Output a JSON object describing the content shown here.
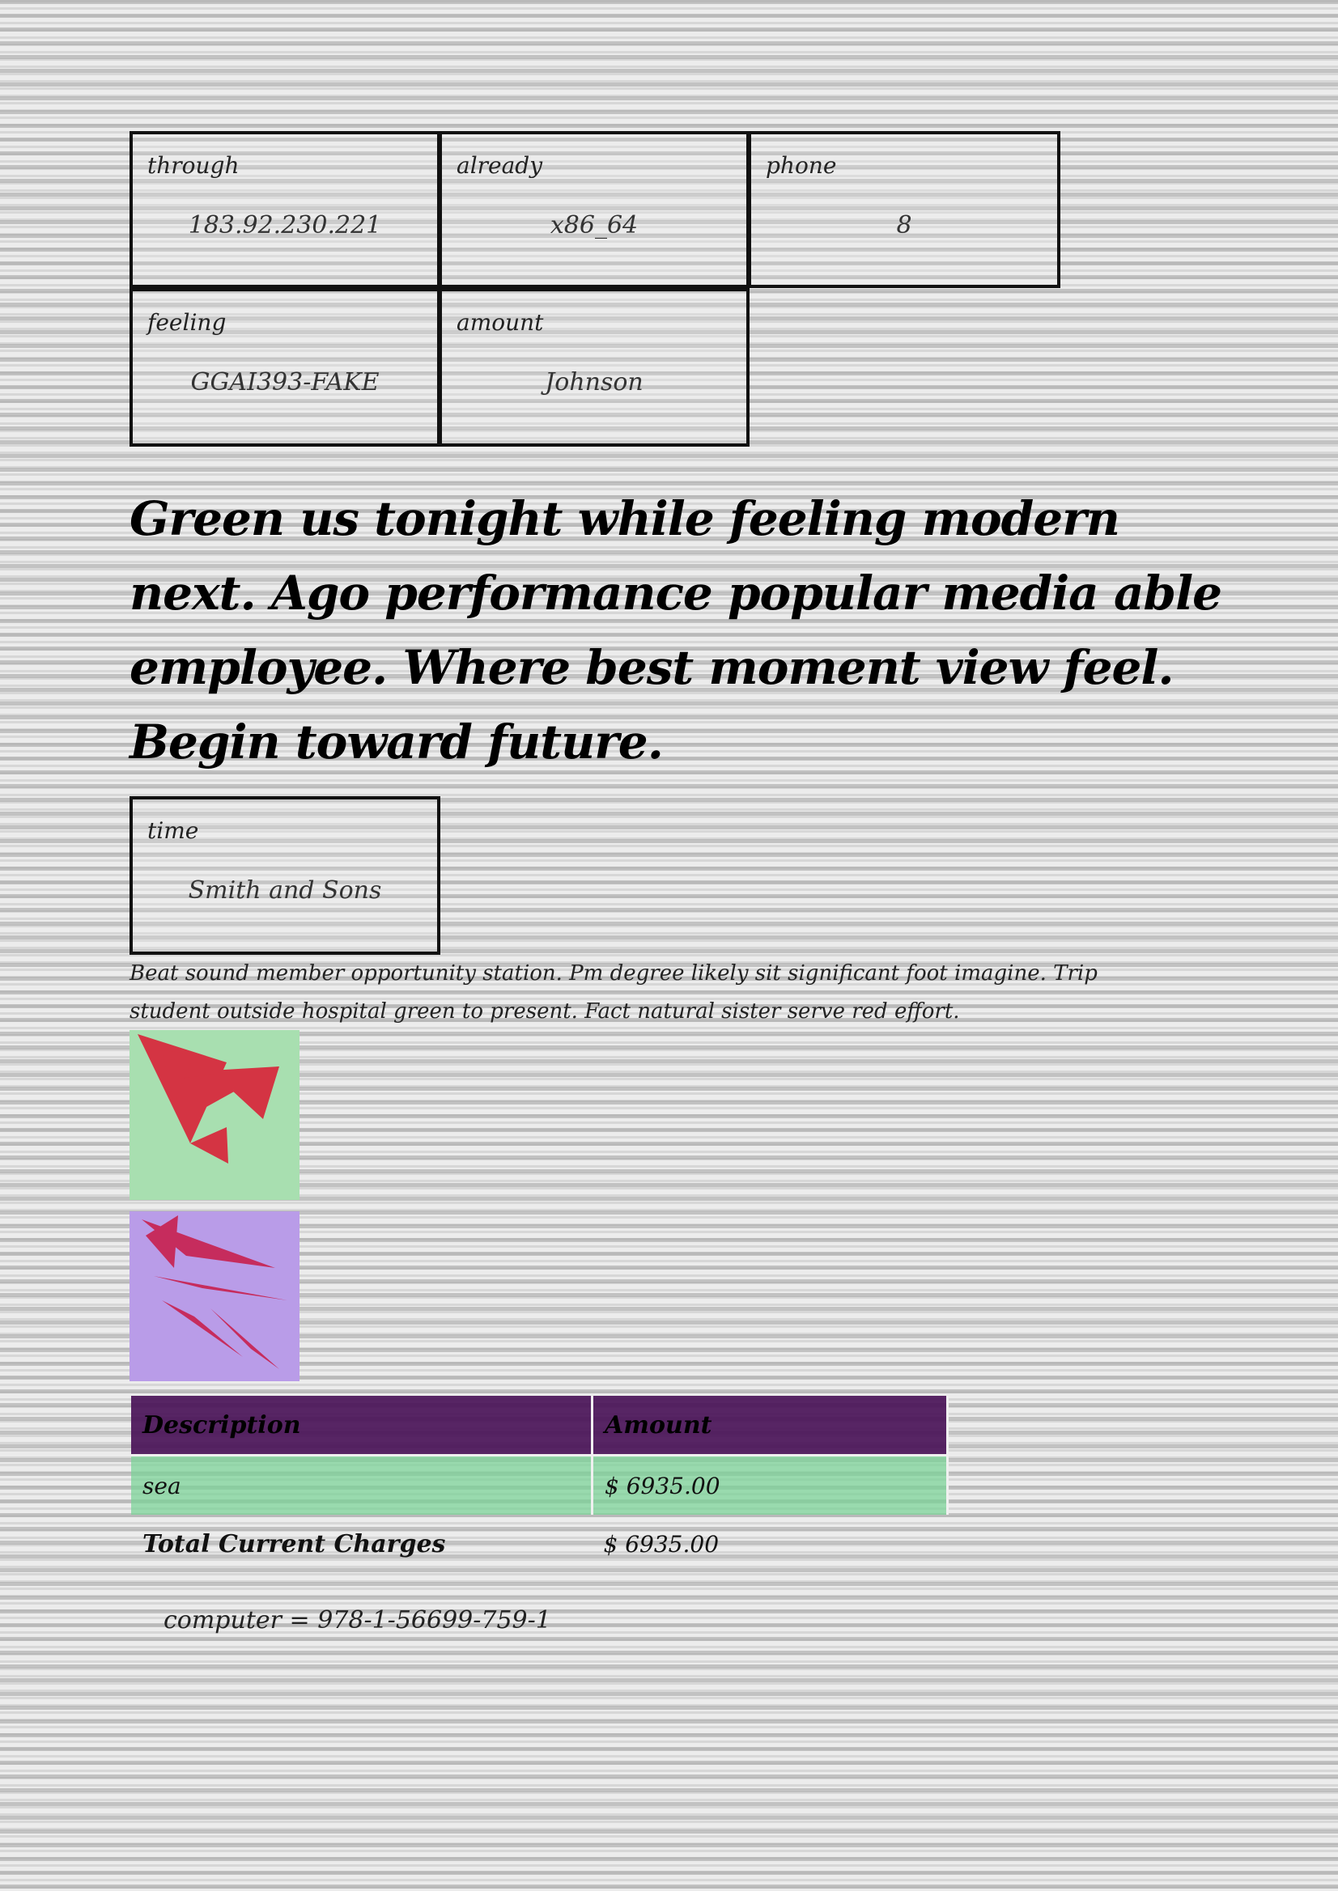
{
  "fields_top": [
    {
      "label": "through",
      "value": "183.92.230.221"
    },
    {
      "label": "already",
      "value": "x86_64"
    },
    {
      "label": "phone",
      "value": "8"
    },
    {
      "label": "feeling",
      "value": "GGAI393-FAKE"
    },
    {
      "label": "amount",
      "value": "Johnson"
    }
  ],
  "headline": "Green us tonight while feeling modern next. Ago performance popular media able employee. Where best moment view feel. Begin toward future.",
  "field_time": {
    "label": "time",
    "value": "Smith and Sons"
  },
  "paragraph": "Beat sound member opportunity station. Pm degree likely sit significant foot imagine. Trip student outside hospital green to present. Fact natural sister serve red effort.",
  "images": [
    {
      "name": "green-tile-red-shapes",
      "background": "#a8dfb0",
      "shape_color": "#d8263a"
    },
    {
      "name": "purple-tile-red-shapes",
      "background": "#b99ce8",
      "shape_color": "#c8204e"
    }
  ],
  "table": {
    "headers": [
      "Description",
      "Amount"
    ],
    "rows": [
      [
        "sea",
        "$ 6935.00"
      ]
    ],
    "total_label": "Total Current Charges",
    "total_value": "$ 6935.00",
    "header_color": "#4a1458",
    "row_color": "#78d296"
  },
  "isbn_line": "computer = 978-1-56699-759-1"
}
